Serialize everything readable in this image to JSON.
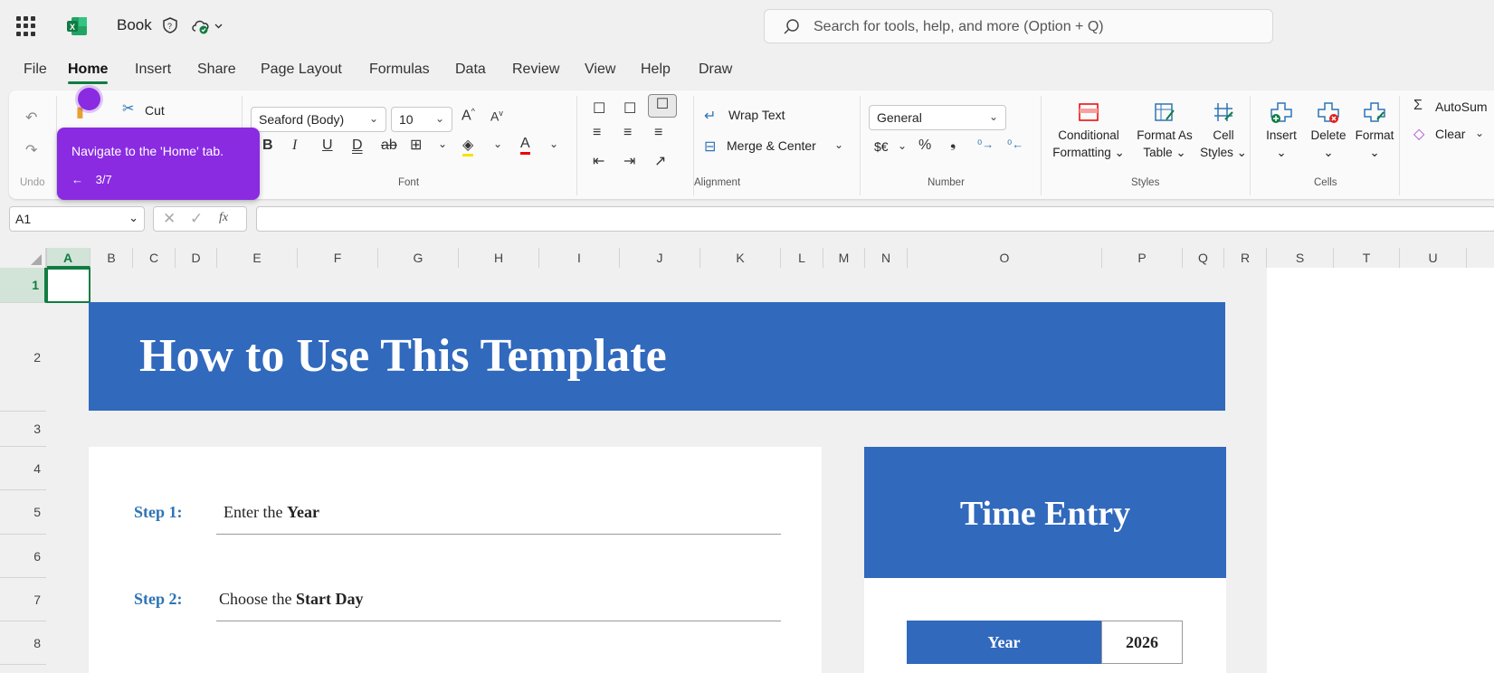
{
  "app": {
    "title": "Book",
    "brand_color": "#107c41"
  },
  "search": {
    "placeholder": "Search for tools, help, and more (Option + Q)"
  },
  "tabs": [
    "File",
    "Home",
    "Insert",
    "Share",
    "Page Layout",
    "Formulas",
    "Data",
    "Review",
    "View",
    "Help",
    "Draw"
  ],
  "active_tab": "Home",
  "ribbon": {
    "clipboard": {
      "cut": "Cut",
      "group_label": "Undo"
    },
    "font": {
      "family": "Seaford (Body)",
      "size": "10",
      "group_label": "Font"
    },
    "alignment": {
      "wrap_text": "Wrap Text",
      "merge_center": "Merge & Center",
      "group_label": "Alignment"
    },
    "number": {
      "format": "General",
      "currency": "$€",
      "group_label": "Number"
    },
    "styles": {
      "conditional_1": "Conditional",
      "conditional_2": "Formatting",
      "table_1": "Format As",
      "table_2": "Table",
      "cell_1": "Cell",
      "cell_2": "Styles",
      "group_label": "Styles"
    },
    "cells": {
      "insert": "Insert",
      "delete": "Delete",
      "format": "Format",
      "group_label": "Cells"
    },
    "editing": {
      "autosum": "AutoSum",
      "clear": "Clear"
    }
  },
  "namebox": "A1",
  "columns": [
    "A",
    "B",
    "C",
    "D",
    "E",
    "F",
    "G",
    "H",
    "I",
    "J",
    "K",
    "L",
    "M",
    "N",
    "O",
    "P",
    "Q",
    "R",
    "S",
    "T",
    "U"
  ],
  "rows": [
    "1",
    "2",
    "3",
    "4",
    "5",
    "6",
    "7",
    "8"
  ],
  "sheet": {
    "banner": "How to Use This Template",
    "step1_label": "Step 1:",
    "step1_text": "Enter the ",
    "step1_bold": "Year",
    "step2_label": "Step 2:",
    "step2_text": "Choose the ",
    "step2_bold": "Start Day",
    "time_entry": "Time Entry",
    "year_label": "Year",
    "year_value": "2026"
  },
  "tooltip": {
    "text": "Navigate to the 'Home' tab.",
    "progress": "3/7",
    "color": "#8a2be2"
  }
}
